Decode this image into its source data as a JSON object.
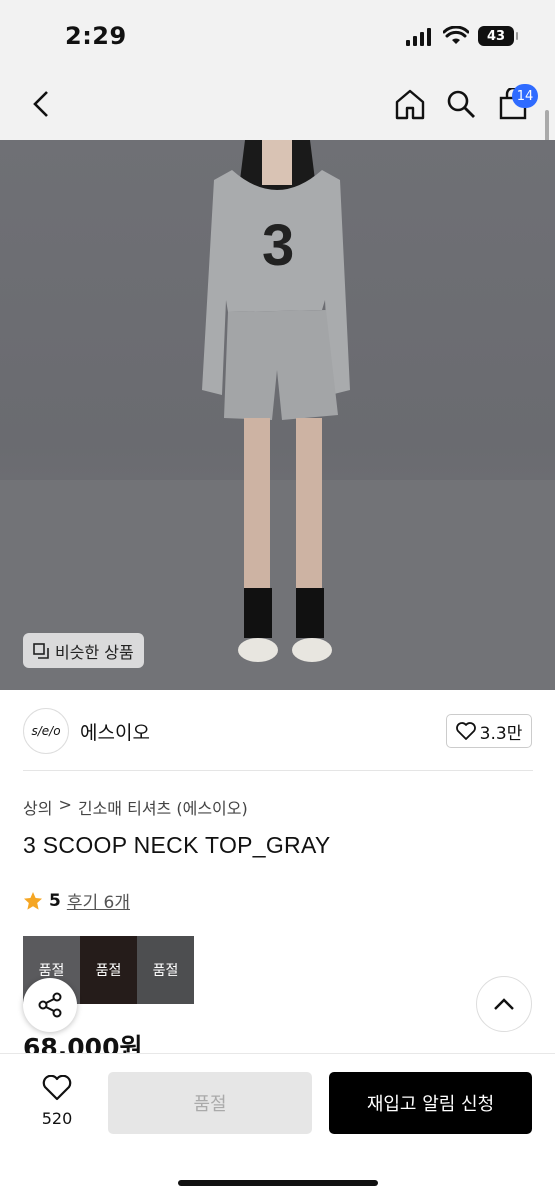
{
  "status": {
    "time": "2:29",
    "battery": "43"
  },
  "nav": {
    "cart_count": "14"
  },
  "hero": {
    "similar_label": "비슷한 상품"
  },
  "brand": {
    "logo_text": "s/e/o",
    "name": "에스이오",
    "likes": "3.3만"
  },
  "breadcrumb": {
    "category": "상의",
    "separator": ">",
    "subcategory": "긴소매 티셔츠 (에스이오)"
  },
  "product": {
    "title": "3 SCOOP NECK TOP_GRAY",
    "rating": "5",
    "review_label": "후기 6개",
    "price": "68,000원",
    "swatches": [
      {
        "label": "품절"
      },
      {
        "label": "품절"
      },
      {
        "label": "품절"
      }
    ]
  },
  "bottom": {
    "wish_count": "520",
    "soldout_label": "품절",
    "notify_label": "재입고 알림 신청"
  },
  "colors": {
    "accent": "#2f6bff",
    "star": "#f5a623",
    "cta": "#000000"
  }
}
